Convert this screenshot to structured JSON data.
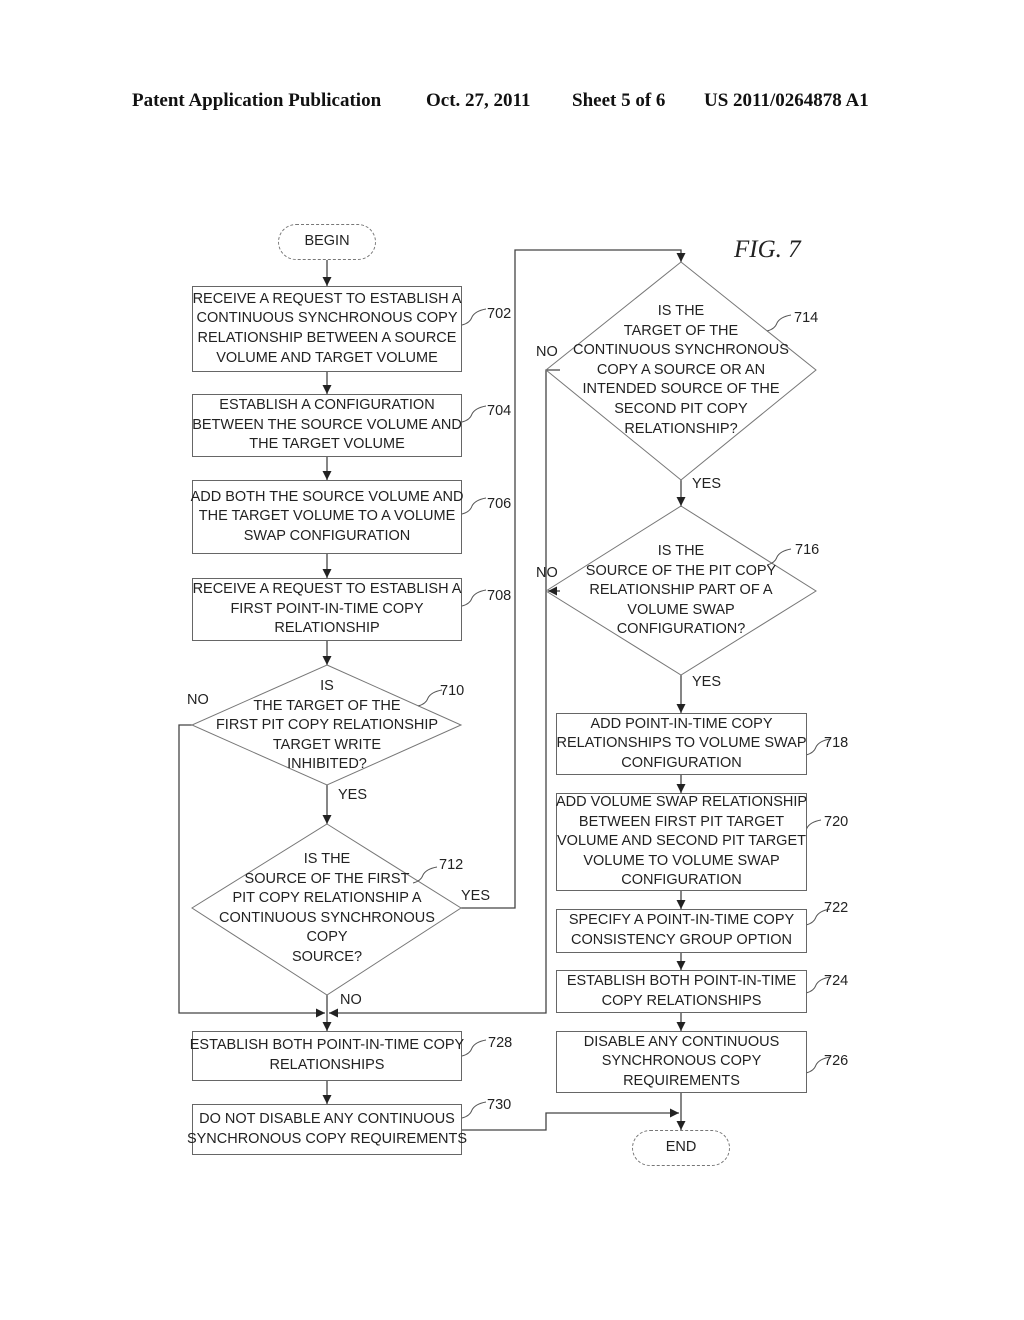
{
  "header": {
    "publication": "Patent Application Publication",
    "date": "Oct. 27, 2011",
    "sheet": "Sheet 5 of 6",
    "number": "US 2011/0264878 A1"
  },
  "figure_label": "FIG. 7",
  "terminals": {
    "begin": "BEGIN",
    "end": "END"
  },
  "steps": {
    "s702": {
      "ref": "702",
      "lines": [
        "RECEIVE A REQUEST TO ESTABLISH A",
        "CONTINUOUS SYNCHRONOUS COPY",
        "RELATIONSHIP BETWEEN A SOURCE",
        "VOLUME AND TARGET VOLUME"
      ]
    },
    "s704": {
      "ref": "704",
      "lines": [
        "ESTABLISH A  CONFIGURATION",
        "BETWEEN THE SOURCE VOLUME AND",
        "THE TARGET VOLUME"
      ]
    },
    "s706": {
      "ref": "706",
      "lines": [
        "ADD BOTH THE SOURCE VOLUME AND",
        "THE TARGET VOLUME TO A VOLUME",
        "SWAP CONFIGURATION"
      ]
    },
    "s708": {
      "ref": "708",
      "lines": [
        "RECEIVE A REQUEST TO ESTABLISH A",
        "FIRST POINT-IN-TIME COPY",
        "RELATIONSHIP"
      ]
    },
    "s718": {
      "ref": "718",
      "lines": [
        "ADD POINT-IN-TIME COPY",
        "RELATIONSHIPS TO VOLUME SWAP",
        "CONFIGURATION"
      ]
    },
    "s720": {
      "ref": "720",
      "lines": [
        "ADD VOLUME SWAP RELATIONSHIP",
        "BETWEEN FIRST PIT TARGET",
        "VOLUME AND SECOND PIT TARGET",
        "VOLUME TO VOLUME SWAP",
        "CONFIGURATION"
      ]
    },
    "s722": {
      "ref": "722",
      "lines": [
        "SPECIFY A POINT-IN-TIME COPY",
        "CONSISTENCY GROUP OPTION"
      ]
    },
    "s724": {
      "ref": "724",
      "lines": [
        "ESTABLISH BOTH POINT-IN-TIME",
        "COPY RELATIONSHIPS"
      ]
    },
    "s726": {
      "ref": "726",
      "lines": [
        "DISABLE ANY CONTINUOUS",
        "SYNCHRONOUS COPY",
        "REQUIREMENTS"
      ]
    },
    "s728": {
      "ref": "728",
      "lines": [
        "ESTABLISH BOTH POINT-IN-TIME COPY",
        "RELATIONSHIPS"
      ]
    },
    "s730": {
      "ref": "730",
      "lines": [
        "DO NOT DISABLE ANY CONTINUOUS",
        "SYNCHRONOUS COPY REQUIREMENTS"
      ]
    }
  },
  "decisions": {
    "d710": {
      "ref": "710",
      "lines": [
        "IS",
        "THE TARGET OF THE",
        "FIRST PIT COPY RELATIONSHIP",
        "TARGET WRITE",
        "INHIBITED?"
      ],
      "yes": "YES",
      "no": "NO"
    },
    "d712": {
      "ref": "712",
      "lines": [
        "IS THE",
        "SOURCE OF THE FIRST",
        "PIT COPY RELATIONSHIP A",
        "CONTINUOUS SYNCHRONOUS",
        "COPY",
        "SOURCE?"
      ],
      "yes": "YES",
      "no": "NO"
    },
    "d714": {
      "ref": "714",
      "lines": [
        "IS THE",
        "TARGET OF THE",
        "CONTINUOUS SYNCHRONOUS",
        "COPY A SOURCE OR AN",
        "INTENDED SOURCE OF THE",
        "SECOND PIT COPY",
        "RELATIONSHIP?"
      ],
      "yes": "YES",
      "no": "NO"
    },
    "d716": {
      "ref": "716",
      "lines": [
        "IS THE",
        "SOURCE OF THE PIT COPY",
        "RELATIONSHIP PART OF A",
        "VOLUME SWAP",
        "CONFIGURATION?"
      ],
      "yes": "YES",
      "no": "NO"
    }
  }
}
